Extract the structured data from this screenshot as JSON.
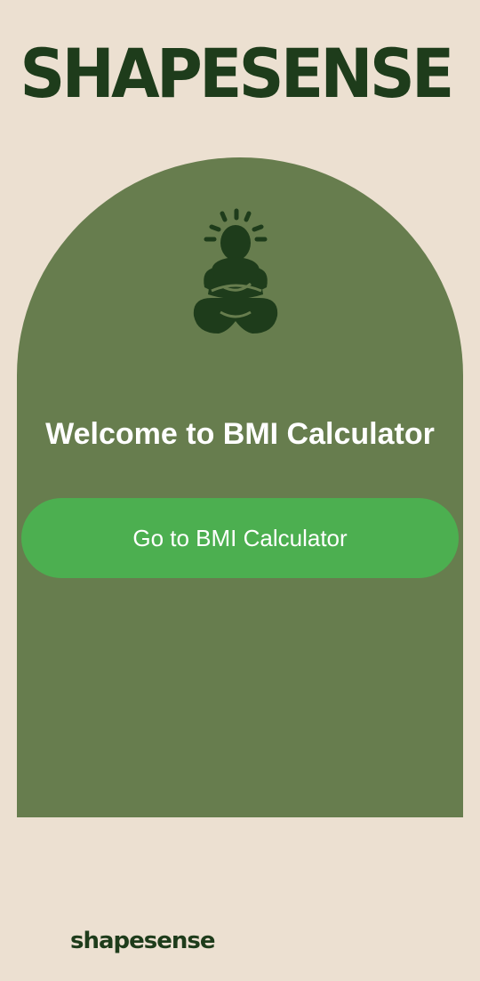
{
  "header": {
    "brand": "SHAPESENSE"
  },
  "hero": {
    "icon": "meditation-figure-icon",
    "welcome_text": "Welcome to BMI Calculator",
    "cta_label": "Go to BMI Calculator"
  },
  "footer": {
    "brand": "shapesense"
  },
  "colors": {
    "background": "#ece0d1",
    "arch": "#677d4e",
    "brand": "#1e3c1b",
    "button": "#4caf50",
    "button_text": "#ffffff"
  }
}
